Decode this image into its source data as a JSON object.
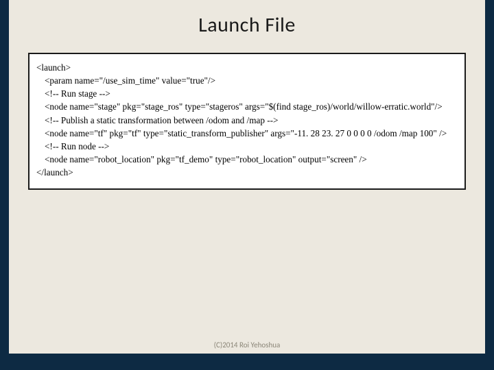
{
  "title": "Launch File",
  "code": {
    "l1": "<launch>",
    "l2": "<param name=\"/use_sim_time\" value=\"true\"/>",
    "l3": "<!-- Run stage -->",
    "l4": "<node name=\"stage\" pkg=\"stage_ros\" type=\"stageros\" args=\"$(find stage_ros)/world/willow-erratic.world\"/>",
    "l5": "<!-- Publish a static transformation between /odom and /map -->",
    "l6": "<node name=\"tf\" pkg=\"tf\" type=\"static_transform_publisher\" args=\"-11. 28 23. 27 0 0 0 0 /odom /map 100\" />",
    "l7": "<!-- Run node -->",
    "l8": "<node name=\"robot_location\" pkg=\"tf_demo\" type=\"robot_location\" output=\"screen\" />",
    "l9": "</launch>"
  },
  "footer": "(C)2014 Roi Yehoshua"
}
